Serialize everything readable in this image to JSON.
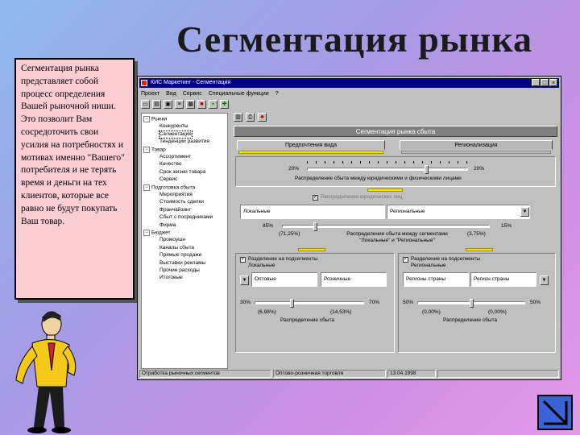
{
  "slide": {
    "title": "Сегментация рынка",
    "body_text": "Сегментация рынка представляет собой процесс определения Вашей рыночной ниши. Это позволит Вам сосредоточить свои усилия на потребностях и мотивах именно \"Вашего\" потребителя и не терять время и деньги на тех клиентов, которые все равно не будут покупать Ваш товар."
  },
  "window": {
    "title": "КИС Маркетинг - Сегментация",
    "controls": [
      "_",
      "□",
      "×"
    ],
    "menu": [
      "Проект",
      "Вид",
      "Сервис",
      "Специальные функции",
      "?"
    ]
  },
  "tree": [
    {
      "label": "Рынки",
      "level": 0
    },
    {
      "label": "Конкуренты",
      "level": 1
    },
    {
      "label": "Сегментация",
      "level": 1,
      "selected": true
    },
    {
      "label": "Тенденции развития",
      "level": 1
    },
    {
      "label": "Товар",
      "level": 0
    },
    {
      "label": "Ассортимент",
      "level": 1
    },
    {
      "label": "Качество",
      "level": 1
    },
    {
      "label": "Срок жизни товара",
      "level": 1
    },
    {
      "label": "Сервис",
      "level": 1
    },
    {
      "label": "Подготовка сбыта",
      "level": 0
    },
    {
      "label": "Мероприятия",
      "level": 1
    },
    {
      "label": "Стоимость сделки",
      "level": 1
    },
    {
      "label": "Франчайзинг",
      "level": 1
    },
    {
      "label": "Сбыт с посредниками",
      "level": 1
    },
    {
      "label": "Фирма",
      "level": 1
    },
    {
      "label": "Бюджет",
      "level": 0
    },
    {
      "label": "Промоушн",
      "level": 1
    },
    {
      "label": "Каналы сбыта",
      "level": 1
    },
    {
      "label": "Прямые продажи",
      "level": 1
    },
    {
      "label": "Выставки рекламы",
      "level": 1
    },
    {
      "label": "Прочие расходы",
      "level": 1
    },
    {
      "label": "Итоговые",
      "level": 1
    }
  ],
  "panel": {
    "title": "Сегментация рынка сбыта",
    "tabs": [
      "Предпочтения вида",
      "Регионализация"
    ],
    "slider1": {
      "left": "20%",
      "right": "20%",
      "caption": "Распределение сбыта между юридическими и физическими лицами"
    },
    "checkbox_main": "Распределение юридических лиц",
    "combo1_left": "Локальные",
    "combo1_right": "Региональные",
    "slider2": {
      "left": "85%",
      "val_left": "(71,25%)",
      "val_right": "(3,75%)",
      "right": "15%",
      "caption": "Распределение сбыта между сегментами \"Локальные\" и \"Региональные\""
    },
    "group_left": {
      "checkbox": "Разделение на подсегменты",
      "title": "Локальные",
      "combo_left": "Оптовые",
      "combo_right": "Розничные",
      "left": "30%",
      "val_left": "(6,98%)",
      "val_right": "(14,53%)",
      "right": "70%",
      "caption": "Распределение сбыта"
    },
    "group_right": {
      "checkbox": "Разделение на подсегменты",
      "title": "Региональные",
      "combo_left": "Регионы страны",
      "combo_right": "Регион страны",
      "left": "50%",
      "val_left": "(0,00%)",
      "val_right": "(0,00%)",
      "right": "50%",
      "caption": "Распределение сбыта"
    }
  },
  "status": [
    "Отработка рыночных сегментов",
    "Оптово-розничная торговля",
    "13.04.1998"
  ]
}
